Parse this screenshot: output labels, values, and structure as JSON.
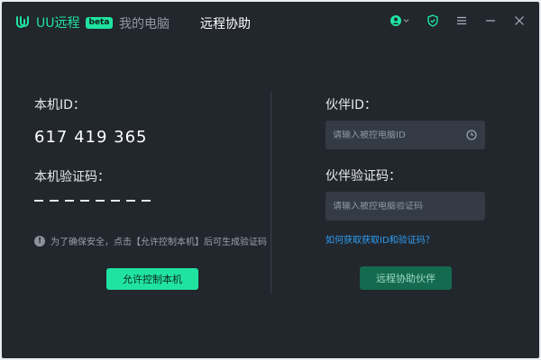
{
  "app": {
    "name": "UU远程",
    "badge": "beta",
    "accent_color": "#20e3a1",
    "background_color": "#22272d"
  },
  "tabs": [
    {
      "label": "我的电脑",
      "active": false
    },
    {
      "label": "远程协助",
      "active": true
    }
  ],
  "window_controls": {
    "user_icon": "user-avatar-icon",
    "shield_icon": "shield-icon",
    "menu_icon": "menu-icon",
    "minimize_icon": "minimize-icon",
    "close_icon": "close-icon"
  },
  "local": {
    "id_label": "本机ID：",
    "id_value": "617 419 365",
    "code_label": "本机验证码：",
    "code_placeholder_length": 8,
    "notice": "为了确保安全，点击【允许控制本机】后可生成验证码",
    "allow_button": "允许控制本机"
  },
  "partner": {
    "id_label": "伙伴ID：",
    "id_placeholder": "请输入被控电脑ID",
    "code_label": "伙伴验证码：",
    "code_placeholder": "请输入被控电脑验证码",
    "help_link": "如何获取获取ID和验证码？",
    "connect_button": "远程协助伙伴"
  }
}
